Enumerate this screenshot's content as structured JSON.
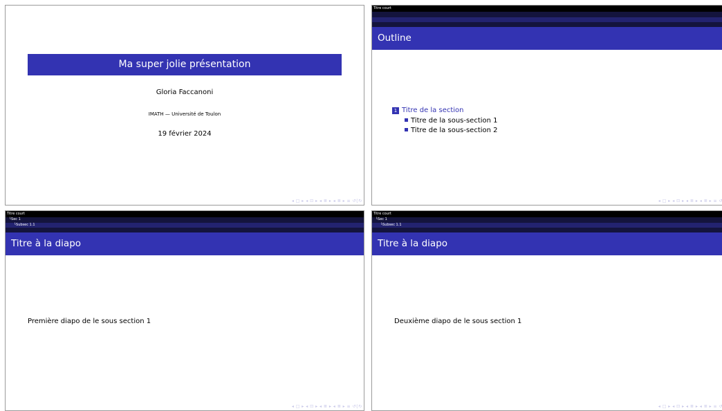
{
  "slide1": {
    "title": "Ma super jolie présentation",
    "author": "Gloria Faccanoni",
    "institute": "IMATH — Université de Toulon",
    "date": "19 février 2024"
  },
  "slide2": {
    "short_title": "Titre court",
    "frame_title": "Outline",
    "section_number": "1",
    "section_title": "Titre de la section",
    "subsections": [
      "Titre de la sous-section 1",
      "Titre de la sous-section 2"
    ]
  },
  "slide3": {
    "short_title": "Titre court",
    "section": "Sec 1",
    "subsection": "Subsec 1.1",
    "frame_title": "Titre à la diapo",
    "body": "Première diapo de le sous section 1"
  },
  "slide4": {
    "short_title": "Titre court",
    "section": "Sec 1",
    "subsection": "Subsec 1.1",
    "frame_title": "Titre à la diapo",
    "body": "Deuxième diapo de le sous section 1"
  },
  "nav_symbols": "◂ □ ▸  ◂ ⊡ ▸  ◂ ≣ ▸  ◂ ≣ ▸   ≡   ↺◊↻"
}
